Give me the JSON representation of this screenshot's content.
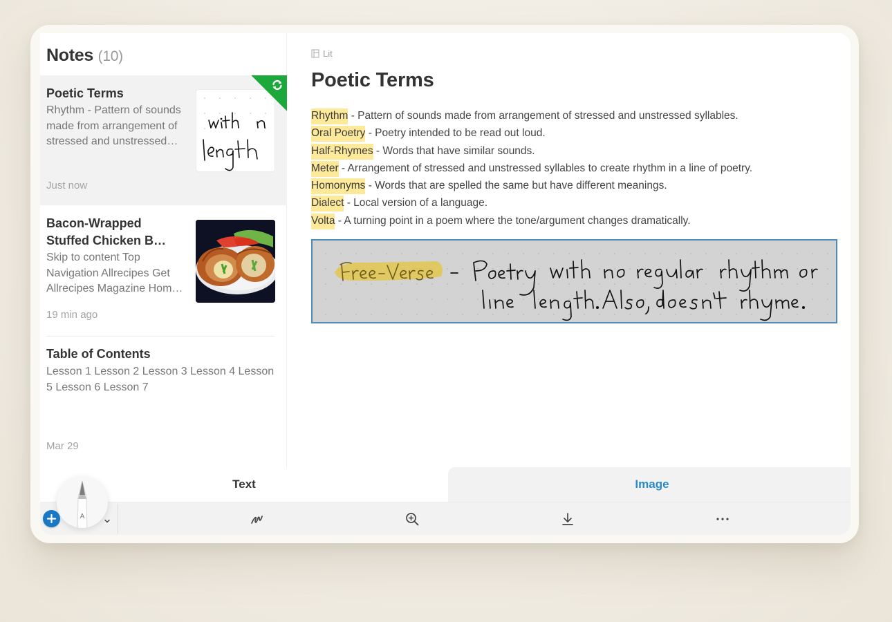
{
  "sidebar": {
    "title": "Notes",
    "count": "(10)",
    "notes": [
      {
        "title": "Poetic Terms",
        "snippet_lines": [
          "Rhythm - Pattern of sounds",
          "made from arrangement of",
          "stressed and unstressed…"
        ],
        "date": "Just now",
        "thumbnail": "handwriting",
        "thumbnail_text": [
          "with n",
          "length"
        ],
        "selected": true,
        "sync_badge": "sync-icon"
      },
      {
        "title_lines": [
          "Bacon-Wrapped",
          "Stuffed Chicken B…"
        ],
        "snippet_lines": [
          "Skip to content Top",
          "Navigation Allrecipes Get",
          "Allrecipes Magazine Hom…"
        ],
        "date": "19 min ago",
        "thumbnail": "food-photo",
        "selected": false
      },
      {
        "title": "Table of Contents",
        "snippet_lines": [
          "Lesson 1 Lesson 2 Lesson 3 Lesson 4 Lesson",
          "5 Lesson 6 Lesson 7"
        ],
        "date": "Mar 29",
        "selected": false
      }
    ]
  },
  "editor": {
    "notebook": "Lit",
    "notebook_icon": "notebook-icon",
    "title": "Poetic Terms",
    "terms": [
      {
        "term": "Rhythm",
        "definition": " - Pattern of sounds made from arrangement of stressed and unstressed syllables."
      },
      {
        "term": "Oral Poetry",
        "definition": " - Poetry intended to be read out loud."
      },
      {
        "term": "Half-Rhymes",
        "definition": " - Words that have similar sounds."
      },
      {
        "term": "Meter",
        "definition": " - Arrangement of stressed and unstressed syllables to create rhythm in a line of poetry."
      },
      {
        "term": "Homonyms",
        "definition": " - Words that are spelled the same but have different meanings."
      },
      {
        "term": "Dialect",
        "definition": " - Local version of a language."
      },
      {
        "term": "Volta",
        "definition": " - A turning point in a poem where the tone/argument changes dramatically."
      }
    ],
    "handwriting": {
      "highlighted": "Free-Verse",
      "line1": "- Poetry with no regular rhythm or",
      "line2": "line length. Also, doesn't rhyme."
    }
  },
  "bottom": {
    "tabs": [
      {
        "label": "Text",
        "active": false
      },
      {
        "label": "Image",
        "active": true
      }
    ],
    "tools": [
      "handwriting-icon",
      "zoom-in-icon",
      "download-icon",
      "more-icon"
    ],
    "pen_letter": "A"
  },
  "colors": {
    "accent": "#2a8ac8",
    "sync_green": "#1da83b",
    "highlight": "#fde99a",
    "ink_border": "#4d8bb8",
    "add_button": "#1a77c2"
  }
}
